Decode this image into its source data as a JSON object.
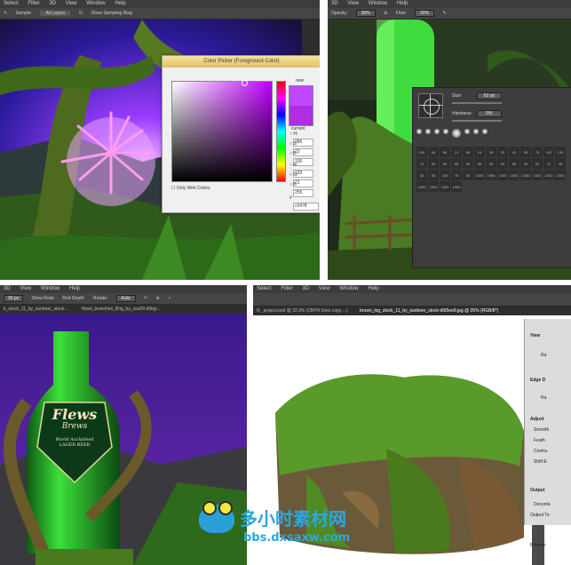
{
  "panel_tl": {
    "menu": [
      "Select",
      "Filter",
      "3D",
      "View",
      "Window",
      "Help"
    ],
    "options": {
      "sample_label": "Sample:",
      "sample_value": "All Layers",
      "show_ring": "Show Sampling Ring"
    },
    "color_picker": {
      "title": "Color Picker (Foreground Color)",
      "new_label": "new",
      "current_label": "current",
      "only_web_colors": "Only Web Colors",
      "fields": [
        {
          "label": "H:",
          "value": "286"
        },
        {
          "label": "S:",
          "value": "72"
        },
        {
          "label": "B:",
          "value": "100"
        },
        {
          "label": "R:",
          "value": "192"
        },
        {
          "label": "G:",
          "value": "71"
        },
        {
          "label": "B:",
          "value": "255"
        }
      ],
      "hex_label": "#",
      "hex_value": "c047ff",
      "new_color": "#c047ff",
      "current_color": "#b02ee0"
    }
  },
  "panel_tr": {
    "menu": [
      "3D",
      "View",
      "Window",
      "Help"
    ],
    "options": {
      "opacity_label": "Opacity:",
      "opacity_value": "30%",
      "flow_label": "Flow:",
      "flow_value": "30%"
    },
    "brush": {
      "size_label": "Size:",
      "size_value": "63 px",
      "hardness_label": "Hardness:",
      "hardness_value": "0%",
      "preset_numbers": [
        "100",
        "45",
        "90",
        "21",
        "60",
        "14",
        "26",
        "33",
        "42",
        "55",
        "70",
        "112",
        "134",
        "74",
        "95",
        "95",
        "90",
        "36",
        "36",
        "33",
        "63",
        "66",
        "39",
        "63",
        "11",
        "48",
        "32",
        "55",
        "100",
        "75",
        "45",
        "1000",
        "1950",
        "1000",
        "1000",
        "1000",
        "1000",
        "1000",
        "1000",
        "1000",
        "1000",
        "1000",
        "1000"
      ]
    }
  },
  "panel_bl": {
    "menu": [
      "3D",
      "View",
      "Window",
      "Help"
    ],
    "options": {
      "angle_label": "Rotate:",
      "size_value": "30 px",
      "show_rods": "Show Rods",
      "rod_depth": "Rod Depth:",
      "angle_value": "Auto"
    },
    "tabs": [
      "k_stock_11_by_sunbeer_stock-...",
      "Heart_branches_Brig_by_sxu09-d5bjy..."
    ],
    "bottle": {
      "brand": "Flews",
      "line": "Brews",
      "sub1": "World Acclaimed",
      "sub2": "LAGER BEER"
    }
  },
  "panel_br": {
    "menu": [
      "Select",
      "Filter",
      "3D",
      "View",
      "Window",
      "Help"
    ],
    "tab": "R_ project.psd @ 33.3% (CMYK lines copy ...)",
    "tab2": "brown_log_stock_11_by_sunbeer_stock-d6t5ee8.jpg @ 25% (RGB/8*)",
    "refine": [
      "View",
      "Ra",
      "Edge D",
      "Ra",
      "Adjust",
      "Smooth",
      "Feath",
      "Contra",
      "Shift E",
      "Output",
      "Deconta",
      "Output To",
      "Remem"
    ]
  },
  "watermark": {
    "cn": "多小时素材网",
    "url": "bbs.dxsaxw.com"
  }
}
